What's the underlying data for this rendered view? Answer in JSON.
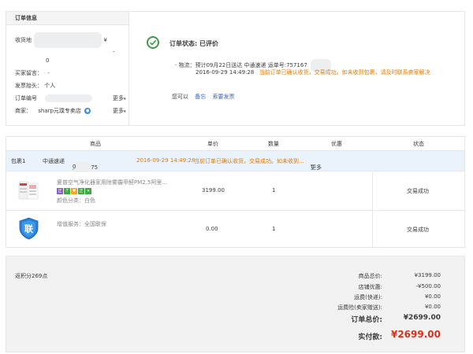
{
  "order_info": {
    "header": "订单信息",
    "address_label": "收货地",
    "address_suffix": "¥",
    "address_dash": "-",
    "address_zero": "0",
    "buyer_msg_label": "买家留言：",
    "buyer_msg_value": "-",
    "invoice_label": "发票抬头：",
    "invoice_value": "个人",
    "order_no_label": "订单编号",
    "more1": "更多",
    "seller_label": "商家：",
    "seller_value": "sharp元璞专卖店",
    "more2": "更多"
  },
  "status": {
    "title": "订单状态: 已评价",
    "logistics_line": "· 物流：预计09月22日送达   中通速递   运单号:757167",
    "time": "2016-09-29 14:49:28",
    "notice": "当前订单已确认收货，交易成功。如未收到包裹，请及时联系卖家解决",
    "you_can": "您可以",
    "memo": "备忘",
    "invoice_req": "索要发票"
  },
  "table": {
    "headers": [
      "商品",
      "单价",
      "数量",
      "优惠",
      "状态"
    ],
    "package": {
      "label": "包裹1",
      "carrier": "中通速递",
      "tracking": "运单号 75",
      "tracking_tail": "0",
      "time": "2016-09-29 14:49:28",
      "notice": "当前订单已确认收货，交易成功。如未收到...",
      "more": "更多"
    },
    "rows": [
      {
        "name": "夏普空气净化器家用除雾霾甲醛PM2.5阿里...",
        "tags": [
          {
            "t": "正",
            "color": "#8c5fc6"
          },
          {
            "t": "7",
            "color": "#3fa944"
          },
          {
            "t": "♥",
            "color": "#f5a623"
          },
          {
            "t": "正",
            "color": "#3fa944"
          },
          {
            "t": "✦",
            "color": "#3fa944"
          }
        ],
        "color_label": "颜色分类：白色",
        "price": "3199.00",
        "qty": "1",
        "status": "交易成功"
      },
      {
        "name": "增值服务：全国联保",
        "price": "0.00",
        "qty": "1",
        "status": "交易成功",
        "badge": "联"
      }
    ]
  },
  "totals": {
    "points": "返积分269点",
    "goods_total_label": "商品总价:",
    "goods_total": "¥3199.00",
    "shop_discount_label": "店铺优惠:",
    "shop_discount": "-¥500.00",
    "shipping_label": "运费(快递):",
    "shipping": "¥0.00",
    "insurance_label": "运费险(卖家赠送):",
    "insurance": "¥0.00",
    "order_total_label": "订单总价:",
    "order_total": "¥2699.00",
    "paid_label": "实付款:",
    "paid": "¥2699.00"
  },
  "colors": {
    "accent_orange": "#e37a00",
    "price_red": "#d9301b",
    "link_blue": "#3366cc",
    "success_green": "#3f9d3f"
  }
}
